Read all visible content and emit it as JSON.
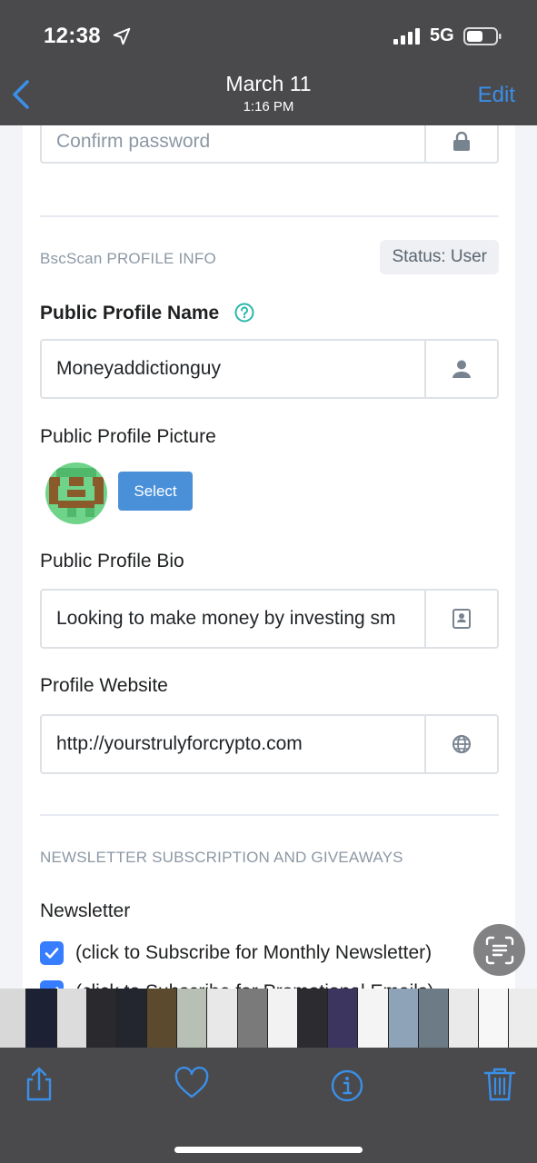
{
  "status_bar": {
    "time": "12:38",
    "network": "5G"
  },
  "nav": {
    "title": "March 11",
    "subtitle": "1:16 PM",
    "edit_label": "Edit"
  },
  "form": {
    "confirm_password": {
      "placeholder": "Confirm password",
      "value": ""
    },
    "section_profile_label": "BscScan PROFILE INFO",
    "status_badge": "Status: User",
    "profile_name": {
      "label": "Public Profile Name",
      "value": "Moneyaddictionguy"
    },
    "profile_picture": {
      "label": "Public Profile Picture",
      "select_label": "Select"
    },
    "profile_bio": {
      "label": "Public Profile Bio",
      "value": "Looking to make money by investing sm"
    },
    "profile_website": {
      "label": "Profile Website",
      "value": "http://yourstrulyforcrypto.com"
    },
    "section_newsletter_label": "NEWSLETTER SUBSCRIPTION AND GIVEAWAYS",
    "newsletter": {
      "label": "Newsletter",
      "options": [
        {
          "label": "(click to Subscribe for Monthly Newsletter)",
          "checked": true
        },
        {
          "label": "(click to Subscribe for Promotional Emails)",
          "checked": true
        }
      ]
    }
  },
  "icons": {
    "lock": "lock-icon",
    "user": "user-icon",
    "contact_book": "contact-book-icon",
    "globe": "globe-icon",
    "help": "question-circle-icon",
    "scan": "live-text-icon",
    "share": "share-icon",
    "favorite": "heart-icon",
    "info": "info-icon",
    "delete": "trash-icon"
  },
  "colors": {
    "accent_ios": "#3a8fe8",
    "accent_site": "#377dff",
    "help": "#2ab7a9",
    "button": "#4a90d9"
  }
}
